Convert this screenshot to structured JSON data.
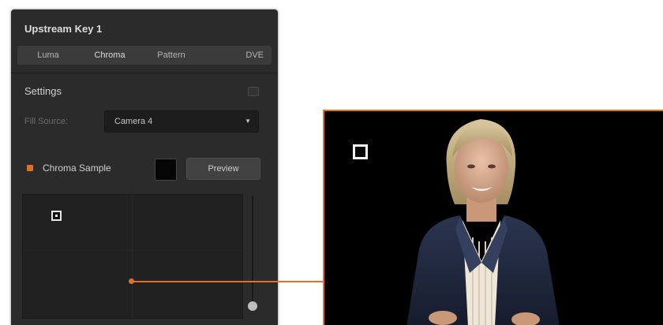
{
  "panel": {
    "title": "Upstream Key 1",
    "tabs": [
      "Luma",
      "Chroma",
      "Pattern",
      "DVE"
    ],
    "active_tab": "Chroma",
    "settings_label": "Settings",
    "fill_source_label": "Fill Source:",
    "fill_source_value": "Camera 4",
    "chroma_sample_label": "Chroma Sample",
    "preview_button": "Preview",
    "sample_color": "#050505"
  },
  "colors": {
    "accent": "#e07024",
    "panel_bg": "#2b2b2b"
  },
  "icons": [
    "settings-toggle-icon",
    "dropdown-arrow-icon",
    "sample-marker-icon",
    "slider-knob-icon",
    "sample-box-icon"
  ]
}
